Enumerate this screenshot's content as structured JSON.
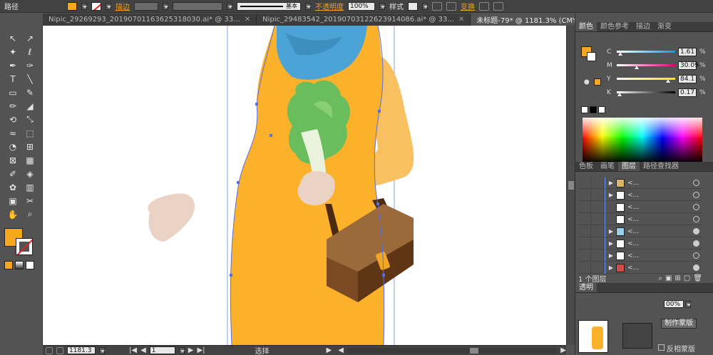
{
  "control_bar": {
    "mode_label": "路径",
    "fill_color": "#f7a81f",
    "stroke_label": "描边",
    "line_style_label": "基本",
    "opacity_label": "不透明度",
    "opacity_value": "100%",
    "style_label": "样式",
    "transform_label": "变换"
  },
  "tabs": [
    {
      "label": "Nipic_29269293_20190701163625318030.ai* @ 33...",
      "close": "✕"
    },
    {
      "label": "Nipic_29483542_20190703122623914086.ai* @ 33...",
      "close": "✕"
    },
    {
      "label": "未标题-79* @ 1181.3% (CMYK/预览)",
      "close": "✕"
    }
  ],
  "tools": [
    "selection-tool",
    "direct-selection-tool",
    "magic-wand-tool",
    "lasso-tool",
    "pen-tool",
    "curvature-tool",
    "type-tool",
    "line-tool",
    "rectangle-tool",
    "paintbrush-tool",
    "pencil-tool",
    "eraser-tool",
    "rotate-tool",
    "scale-tool",
    "width-tool",
    "free-transform-tool",
    "shape-builder-tool",
    "perspective-tool",
    "mesh-tool",
    "gradient-tool",
    "eyedropper-tool",
    "blend-tool",
    "symbol-sprayer-tool",
    "column-graph-tool",
    "artboard-tool",
    "slice-tool",
    "hand-tool",
    "zoom-tool"
  ],
  "tool_glyphs": [
    "↖",
    "↗",
    "✦",
    "ℓ",
    "✒",
    "✑",
    "T",
    "╲",
    "▭",
    "✎",
    "✏",
    "◢",
    "⟲",
    "⤡",
    "≈",
    "⬚",
    "◔",
    "⊞",
    "⊠",
    "▦",
    "✐",
    "◈",
    "✿",
    "▥",
    "▣",
    "✂",
    "✋",
    "⌕"
  ],
  "colors": {
    "fill": "#f7a81f",
    "dress": "#fbb12a",
    "arm": "#f8c05e",
    "scarf": "#4ca3d6",
    "skin": "#ead2c4",
    "bag": "#7b4a22",
    "bag_flap": "#9b6a3a",
    "clasp": "#f0a824",
    "lettuce": "#69bd5d",
    "lettuce_light": "#e9f2dc",
    "path": "#5a6ee0",
    "guide": "#8aa0e0"
  },
  "status_bar": {
    "zoom": "1181.3",
    "page": "1",
    "tool_name": "选择"
  },
  "color_panel": {
    "tabs": [
      "颜色",
      "颜色参考",
      "描边",
      "渐变"
    ],
    "channels": [
      {
        "label": "C",
        "value": "1.61",
        "position": 0.02,
        "gradient": "linear-gradient(to right,#fff,#00a0e0)"
      },
      {
        "label": "M",
        "value": "30.09",
        "position": 0.3,
        "gradient": "linear-gradient(to right,#fff,#e0007f)"
      },
      {
        "label": "Y",
        "value": "84.1",
        "position": 0.84,
        "gradient": "linear-gradient(to right,#fff,#ffe600)"
      },
      {
        "label": "K",
        "value": "0.17",
        "position": 0.01,
        "gradient": "linear-gradient(to right,#fff,#000)"
      }
    ],
    "unit": "%"
  },
  "layers_panel": {
    "tabs": [
      "色板",
      "画笔",
      "图层",
      "路径查找器"
    ],
    "rows": [
      {
        "name": "<...",
        "thumb": "#d9b46a",
        "expandable": true,
        "target_filled": false
      },
      {
        "name": "<...",
        "thumb": "#ffffff",
        "expandable": true,
        "target_filled": false
      },
      {
        "name": "<...",
        "thumb": "#ffffff",
        "expandable": false,
        "target_filled": false
      },
      {
        "name": "<...",
        "thumb": "#ffffff",
        "expandable": false,
        "target_filled": false
      },
      {
        "name": "<...",
        "thumb": "#9bd0e8",
        "expandable": true,
        "target_filled": true
      },
      {
        "name": "<...",
        "thumb": "#ffffff",
        "expandable": true,
        "target_filled": true
      },
      {
        "name": "<...",
        "thumb": "#ffffff",
        "expandable": true,
        "target_filled": false
      },
      {
        "name": "<...",
        "thumb": "#d24a4a",
        "expandable": true,
        "target_filled": true
      }
    ],
    "layer_count": "1 个图层"
  },
  "transparency_panel": {
    "tab": "透明",
    "opacity_value": "00%",
    "make_mask_button": "制作蒙版",
    "invert_mask_label": "反相蒙版"
  }
}
